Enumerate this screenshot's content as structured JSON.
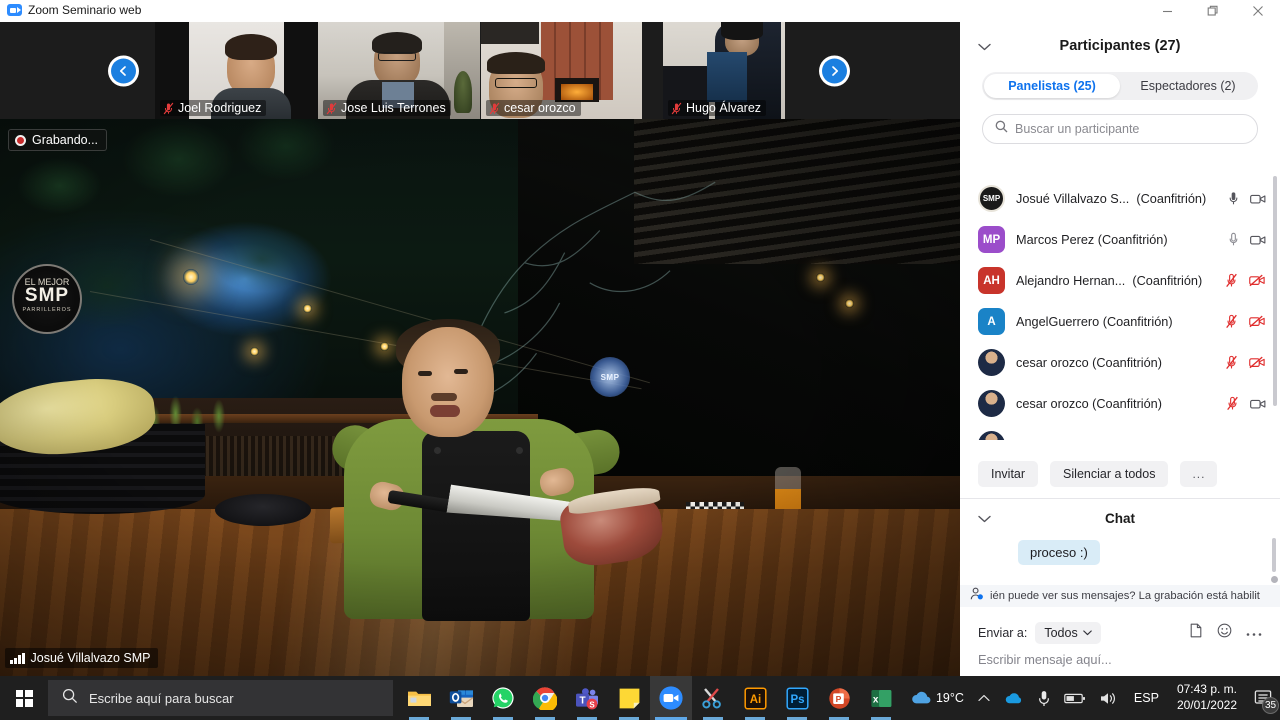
{
  "window": {
    "title": "Zoom Seminario web",
    "app_icon": "zoom-video-icon",
    "controls": {
      "minimize": "minimize-icon",
      "restore": "restore-icon",
      "close": "close-icon"
    }
  },
  "filmstrip": {
    "prev_label": "‹",
    "next_label": "›",
    "thumbs": [
      {
        "name": "Joel Rodriguez",
        "muted": true
      },
      {
        "name": "Jose Luis Terrones",
        "muted": true
      },
      {
        "name": "cesar orozco",
        "muted": true
      },
      {
        "name": "Hugo Álvarez",
        "muted": true
      }
    ]
  },
  "stage": {
    "recording_label": "Grabando...",
    "watermark": "SMP",
    "watermark_sub": "PARRILLEROS",
    "watermark_top": "EL MEJOR",
    "active_speaker": "Josué Villalvazo SMP"
  },
  "participants_panel": {
    "title": "Participantes (27)",
    "collapse_icon": "chevron-down-icon",
    "tabs": [
      {
        "label": "Panelistas (25)",
        "active": true
      },
      {
        "label": "Espectadores (2)",
        "active": false
      }
    ],
    "search_placeholder": "Buscar un participante",
    "search_icon": "search-icon",
    "rows": [
      {
        "name": "Josué Villalvazo S...",
        "role": "(Coanfitrión)",
        "avatar_type": "logo",
        "avatar_text": "SMP",
        "avatar_color": "#1a1a1a",
        "mic": "on",
        "cam": "on"
      },
      {
        "name": "Marcos Perez (Coanfitrión)",
        "role": "",
        "avatar_type": "initials",
        "avatar_text": "MP",
        "avatar_color": "#9b4dca",
        "mic": "off-gray",
        "cam": "on"
      },
      {
        "name": "Alejandro Hernan...",
        "role": "(Coanfitrión)",
        "avatar_type": "initials",
        "avatar_text": "AH",
        "avatar_color": "#c8342b",
        "mic": "muted",
        "cam": "muted"
      },
      {
        "name": "AngelGuerrero (Coanfitrión)",
        "role": "",
        "avatar_type": "initials",
        "avatar_text": "A",
        "avatar_color": "#1a83c7",
        "mic": "muted",
        "cam": "muted"
      },
      {
        "name": "cesar orozco (Coanfitrión)",
        "role": "",
        "avatar_type": "photo",
        "avatar_text": "",
        "avatar_color": "#2b3b55",
        "mic": "muted",
        "cam": "muted"
      },
      {
        "name": "cesar orozco (Coanfitrión)",
        "role": "",
        "avatar_type": "photo",
        "avatar_text": "",
        "avatar_color": "#2b3b55",
        "mic": "muted",
        "cam": "on"
      }
    ],
    "actions": [
      {
        "label": "Invitar",
        "name": "invite-button"
      },
      {
        "label": "Silenciar a todos",
        "name": "mute-all-button"
      },
      {
        "label": "...",
        "name": "more-options-button"
      }
    ]
  },
  "chat_panel": {
    "title": "Chat",
    "collapse_icon": "chevron-down-icon",
    "messages": [
      {
        "text": "proceso :)"
      }
    ],
    "notice": "ién puede ver sus mensajes? La grabación está habilit",
    "notice_icon": "person-privacy-icon",
    "send_to_label": "Enviar a:",
    "send_to_value": "Todos",
    "input_placeholder": "Escribir mensaje aquí...",
    "icons": [
      "file-icon",
      "emoji-icon",
      "more-icon"
    ]
  },
  "taskbar": {
    "start_icon": "windows-start-icon",
    "search_icon": "search-icon",
    "search_placeholder": "Escribe aquí para buscar",
    "apps": [
      {
        "name": "file-explorer-icon",
        "state": "open"
      },
      {
        "name": "outlook-icon",
        "state": "open"
      },
      {
        "name": "whatsapp-icon",
        "state": "open"
      },
      {
        "name": "chrome-icon",
        "state": "open"
      },
      {
        "name": "teams-icon",
        "state": "open"
      },
      {
        "name": "sticky-notes-icon",
        "state": "open"
      },
      {
        "name": "zoom-icon",
        "state": "active"
      },
      {
        "name": "snipping-tool-icon",
        "state": "open"
      },
      {
        "name": "illustrator-icon",
        "state": "open"
      },
      {
        "name": "photoshop-icon",
        "state": "open"
      },
      {
        "name": "powerpoint-icon",
        "state": "open"
      },
      {
        "name": "excel-icon",
        "state": "open"
      }
    ],
    "tray": {
      "weather_icon": "cloud-icon",
      "temperature": "19°C",
      "chevron": "chevron-up-icon",
      "onedrive_icon": "onedrive-icon",
      "mic_icon": "microphone-icon",
      "battery_icon": "battery-icon",
      "volume_icon": "speaker-icon",
      "language": "ESP",
      "time": "07:43 p. m.",
      "date": "20/01/2022",
      "notifications_icon": "notifications-icon",
      "notifications_count": "35"
    }
  },
  "colors": {
    "accent": "#0e72ed",
    "muted_red": "#e02d2d",
    "bubble": "#d9ecf7",
    "taskbar": "#1f1f1f"
  }
}
